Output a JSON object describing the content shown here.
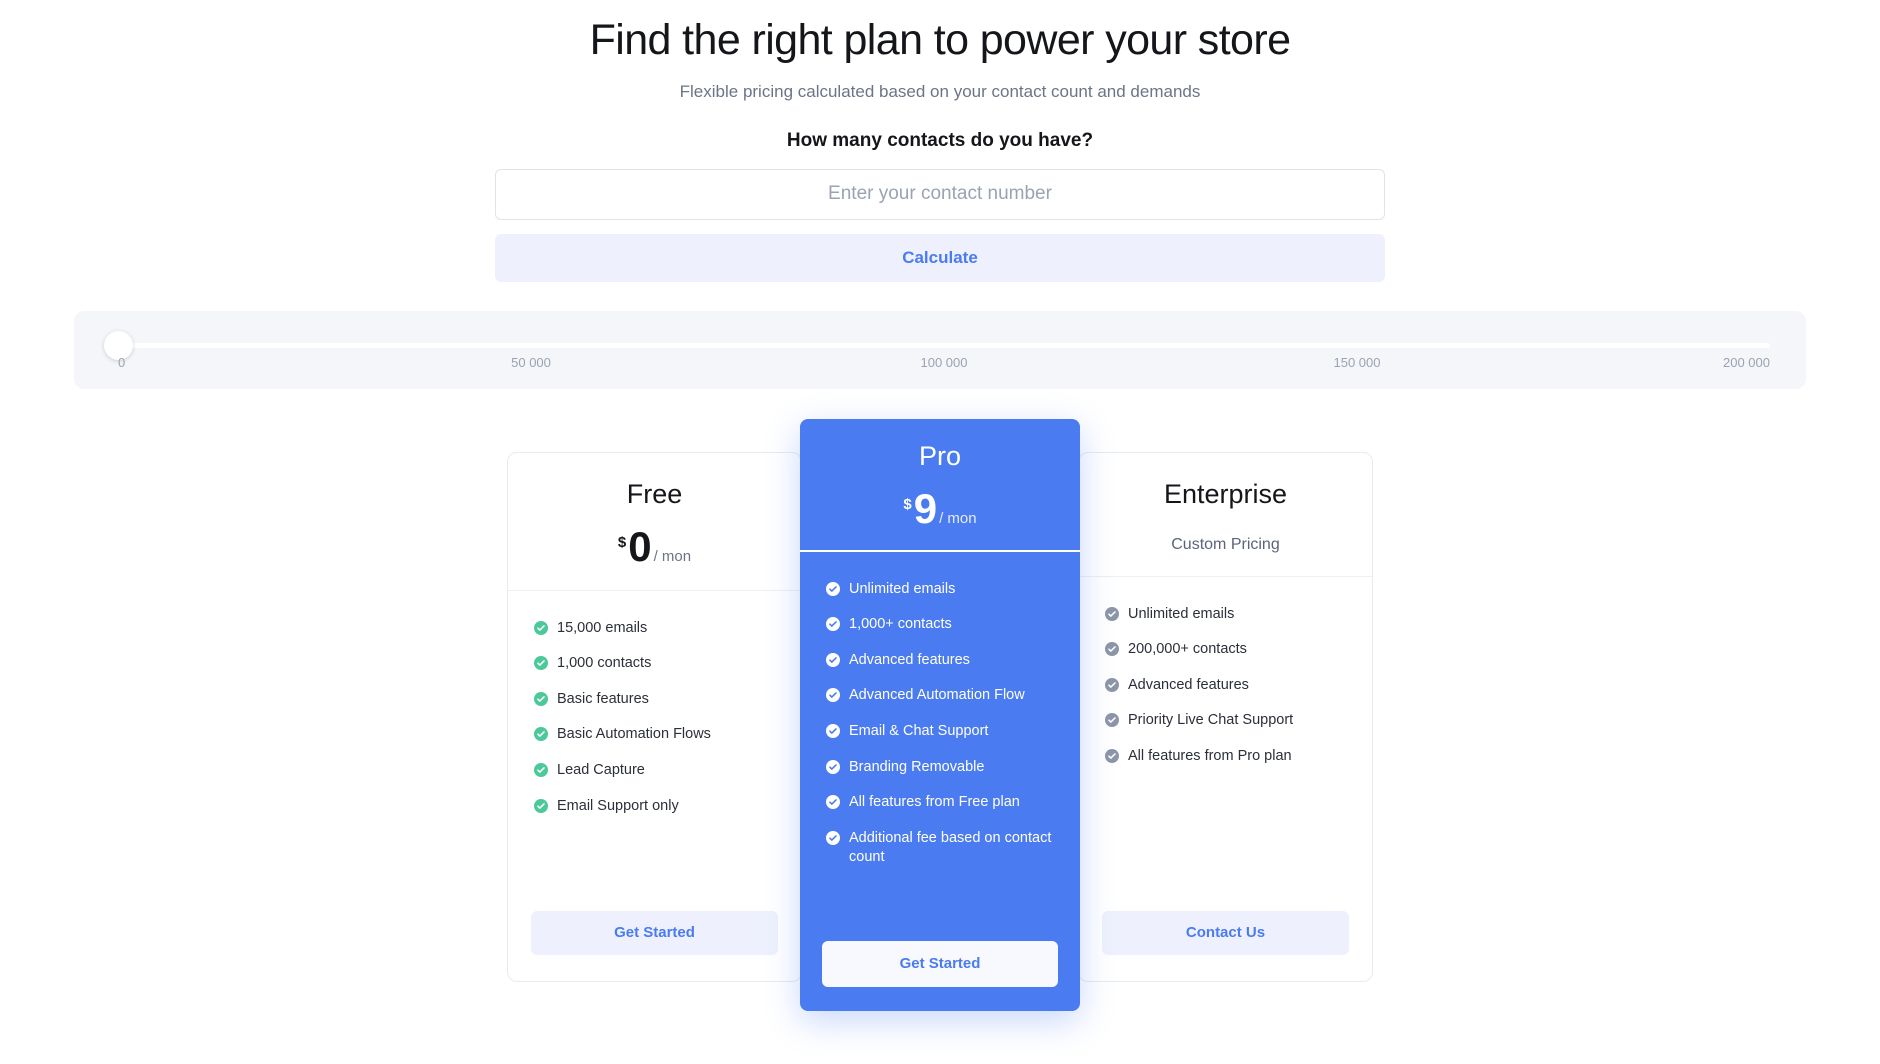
{
  "hero": {
    "title": "Find the right plan to power your store",
    "subtitle": "Flexible pricing calculated based on your contact count and demands"
  },
  "calculator": {
    "question": "How many contacts do you have?",
    "input_value": "",
    "input_placeholder": "Enter your contact number",
    "button_label": "Calculate"
  },
  "slider": {
    "value": 0,
    "min": 0,
    "max": 200000,
    "ticks": [
      "0",
      "50 000",
      "100 000",
      "150 000",
      "200 000"
    ]
  },
  "colors": {
    "accent_blue": "#4a7bf0",
    "accent_blue_soft": "#eef1fd",
    "check_green": "#4cc99a",
    "check_gray": "#8d96a8",
    "slider_bg": "#f4f6fa"
  },
  "plans": [
    {
      "id": "free",
      "name": "Free",
      "currency": "$",
      "amount": "0",
      "period": "/ mon",
      "custom_price": "",
      "check_color": "#4cc99a",
      "features": [
        "15,000 emails",
        "1,000 contacts",
        "Basic features",
        "Basic Automation Flows",
        "Lead Capture",
        "Email Support only"
      ],
      "cta_label": "Get Started"
    },
    {
      "id": "pro",
      "name": "Pro",
      "currency": "$",
      "amount": "9",
      "period": "/ mon",
      "custom_price": "",
      "check_color": "#ffffff",
      "features": [
        "Unlimited emails",
        "1,000+ contacts",
        "Advanced features",
        "Advanced Automation Flow",
        "Email & Chat Support",
        "Branding Removable",
        "All features from Free plan",
        "Additional fee based on contact count"
      ],
      "cta_label": "Get Started"
    },
    {
      "id": "enterprise",
      "name": "Enterprise",
      "currency": "",
      "amount": "",
      "period": "",
      "custom_price": "Custom Pricing",
      "check_color": "#8d96a8",
      "features": [
        "Unlimited emails",
        "200,000+ contacts",
        "Advanced features",
        "Priority Live Chat Support",
        "All features from Pro plan"
      ],
      "cta_label": "Contact Us"
    }
  ]
}
